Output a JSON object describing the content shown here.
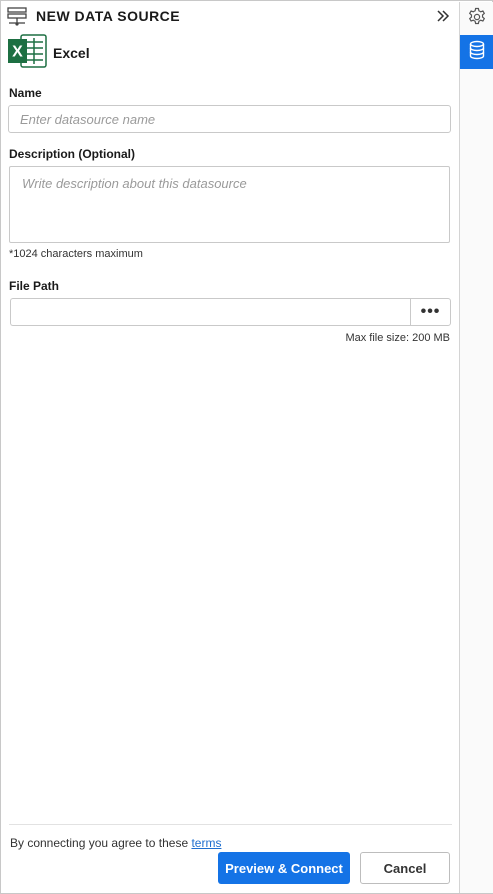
{
  "header": {
    "title": "NEW DATA SOURCE",
    "icon": "data-source-icon",
    "collapse_icon": "double-chevron-right-icon"
  },
  "provider": {
    "name": "Excel",
    "icon": "excel-icon",
    "icon_color": "#1d6f42"
  },
  "form": {
    "name_label": "Name",
    "name_placeholder": "Enter datasource name",
    "name_value": "",
    "description_label": "Description (Optional)",
    "description_placeholder": "Write description about this datasource",
    "description_value": "",
    "description_hint": "*1024 characters maximum",
    "file_path_label": "File Path",
    "file_path_value": "",
    "browse_label": "•••",
    "max_file_size": "Max file size: 200 MB"
  },
  "footer": {
    "terms_text": "By connecting you agree to these ",
    "terms_link": "terms",
    "primary_button": "Preview & Connect",
    "secondary_button": "Cancel"
  },
  "rail": {
    "items": [
      {
        "icon": "gear-icon",
        "active": false
      },
      {
        "icon": "database-icon",
        "active": true
      }
    ]
  },
  "colors": {
    "accent": "#1473e6",
    "link": "#1f6fcf",
    "excel_green": "#1d6f42"
  }
}
